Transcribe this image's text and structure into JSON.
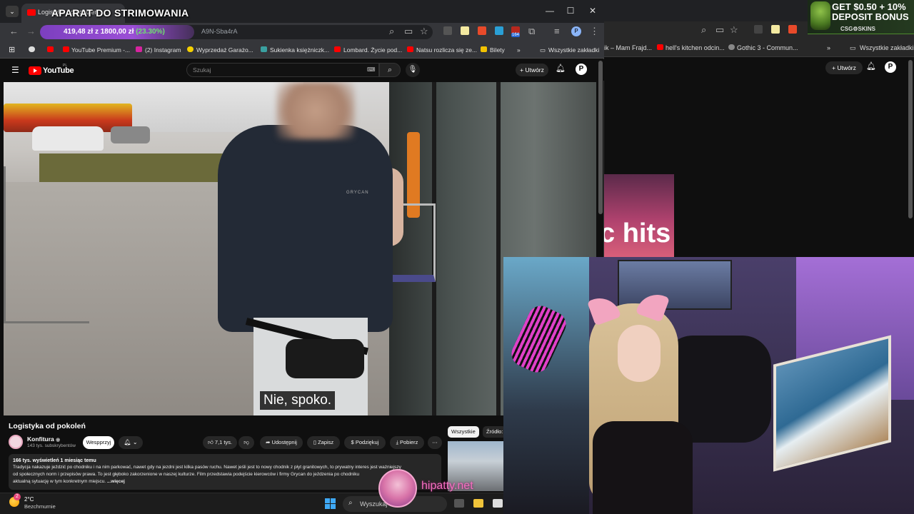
{
  "stream_overlay": {
    "title": "APARAT DO STRIMOWANIA",
    "sponsor": {
      "line1": "GET $0.50 + 10%",
      "line2": "DEPOSIT BONUS",
      "brand": "CSG⚙SKINS"
    },
    "watermark": "hipatty.net"
  },
  "browser": {
    "tab_title": "Logistyka od pokoleń",
    "url_partial": "A9N-Sba4rA",
    "stats": {
      "balance": "419,48 zł",
      "of_label": "z",
      "target": "1800,00 zł",
      "percent": "(23.30%)"
    },
    "window_buttons": {
      "minimize": "—",
      "maximize": "☐",
      "close": "✕"
    },
    "bookmarks": [
      "YouTube Premium -...",
      "(2) Instagram",
      "Wyprzedaż Garażo...",
      "Sukienka księżniczk...",
      "Lombard. Życie pod...",
      "Natsu rozlicza się ze...",
      "Bilety"
    ],
    "bookmarks_more": "»",
    "all_bookmarks": "Wszystkie zakładki",
    "extension_badge": "164"
  },
  "background_browser": {
    "bookmarks": [
      "ik – Mam Frajd...",
      "hell's kitchen odcin...",
      "Gothic 3 - Commun..."
    ],
    "all_bookmarks": "Wszystkie zakładki",
    "create_label": "Utwórz",
    "avatar_letter": "P",
    "thumb_text": "c hits"
  },
  "youtube": {
    "logo_text": "YouTube",
    "logo_region": "PL",
    "search_placeholder": "Szukaj",
    "create_label": "Utwórz",
    "avatar_letter": "P",
    "subtitle": "Nie, spoko.",
    "video_title": "Logistyka od pokoleń",
    "video_shirt_logo": "GRYCAN",
    "channel": {
      "name": "Konfitura",
      "subs": "143 tys. subskrybentów"
    },
    "support_label": "Wespprzyj",
    "actions": {
      "likes": "7,1 tys.",
      "share": "Udostępnij",
      "save": "Zapisz",
      "thanks": "Podziękuj",
      "download": "Pobierz",
      "more": "⋯"
    },
    "description": {
      "meta": "166 tys. wyświetleń  1 miesiąc temu",
      "line1": "Tradycja nakazuje jeździć po chodniku i na nim parkować, nawet gdy na jezdni jest kilka pasów ruchu. Nawet jeśli jest to nowy chodnik z płyt granitowych, to prywatny interes jest ważniejszy",
      "line2": "od społecznych norm i przepisów prawa. To jest głęboko zakorzenione w naszej kulturze. Film przedstawia podejście kierowców i firmy Grycan do jeźdzenia po chodniku",
      "line3": "aktualną sytuację w tym konkretnym miejscu.",
      "more": "...więcej"
    },
    "chips": [
      "Wszystkie",
      "Źródło:"
    ]
  },
  "taskbar": {
    "weather_temp": "2°C",
    "weather_desc": "Bezchmurnie",
    "weather_badge": "2",
    "search_placeholder": "Wyszukaj"
  }
}
